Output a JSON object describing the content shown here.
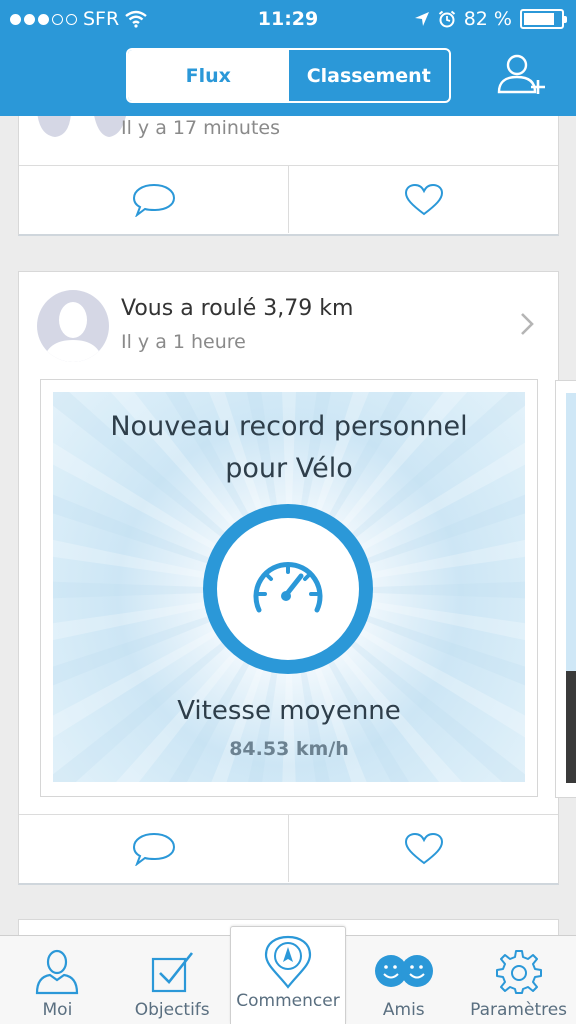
{
  "status_bar": {
    "carrier": "SFR",
    "time": "11:29",
    "battery": "82 %",
    "battery_level": 0.82,
    "signal_bars": 3
  },
  "header": {
    "tabs": [
      {
        "label": "Flux",
        "active": true
      },
      {
        "label": "Classement",
        "active": false
      }
    ],
    "add_friend_icon": "add-user-icon"
  },
  "feed": {
    "top_card": {
      "time": "Il y a 17 minutes"
    },
    "main_card": {
      "title": "Vous a roulé 3,79 km",
      "time": "Il y a 1 heure",
      "record": {
        "title_line1": "Nouveau record personnel",
        "title_line2": "pour Vélo",
        "label": "Vitesse moyenne",
        "value": "84.53 km/h"
      }
    }
  },
  "tabbar": {
    "items": [
      {
        "label": "Moi",
        "icon": "person-icon"
      },
      {
        "label": "Objectifs",
        "icon": "checkbox-icon"
      },
      {
        "label": "Commencer",
        "icon": "compass-pin-icon"
      },
      {
        "label": "Amis",
        "icon": "friends-icon"
      },
      {
        "label": "Paramètres",
        "icon": "gear-icon"
      }
    ]
  },
  "colors": {
    "accent": "#2b98d8",
    "background": "#ececec",
    "tab_label": "#5a6f80"
  }
}
